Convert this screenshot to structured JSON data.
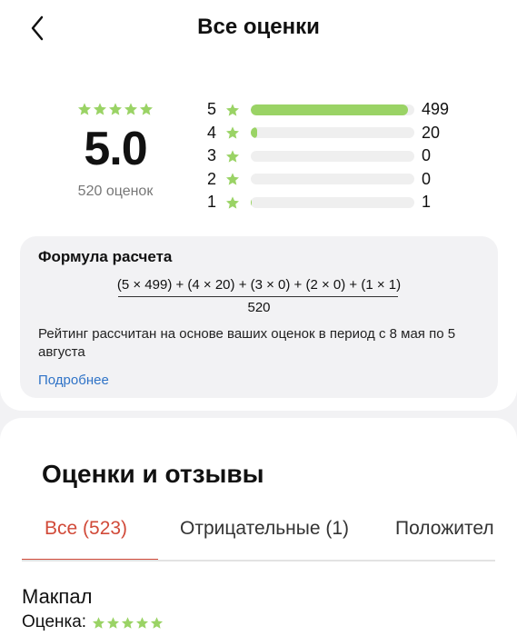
{
  "header": {
    "title": "Все оценки",
    "back_icon": "chevron-left-icon"
  },
  "summary": {
    "score": "5.0",
    "count_label": "520 оценок",
    "stars": 5
  },
  "distribution": [
    {
      "stars": "5",
      "count": "499",
      "fraction": 0.96
    },
    {
      "stars": "4",
      "count": "20",
      "fraction": 0.04
    },
    {
      "stars": "3",
      "count": "0",
      "fraction": 0
    },
    {
      "stars": "2",
      "count": "0",
      "fraction": 0
    },
    {
      "stars": "1",
      "count": "1",
      "fraction": 0.005
    }
  ],
  "formula": {
    "title": "Формула расчета",
    "numerator": "(5 × 499) + (4 × 20) + (3 × 0) + (2 × 0) + (1 × 1)",
    "denominator": "520",
    "description": "Рейтинг рассчитан на основе ваших оценок в период с 8 мая по 5 августа",
    "more_link": "Подробнее"
  },
  "reviews_section": {
    "title": "Оценки и отзывы",
    "tabs": [
      {
        "label": "Все (523)",
        "active": true
      },
      {
        "label": "Отрицательные (1)",
        "active": false
      },
      {
        "label": "Положительные",
        "active": false
      }
    ]
  },
  "review": {
    "author": "Макпал",
    "rating_label": "Оценка:",
    "stars": 5
  },
  "colors": {
    "star": "#9ad365",
    "accent": "#d14a39",
    "link": "#2f73c7"
  }
}
